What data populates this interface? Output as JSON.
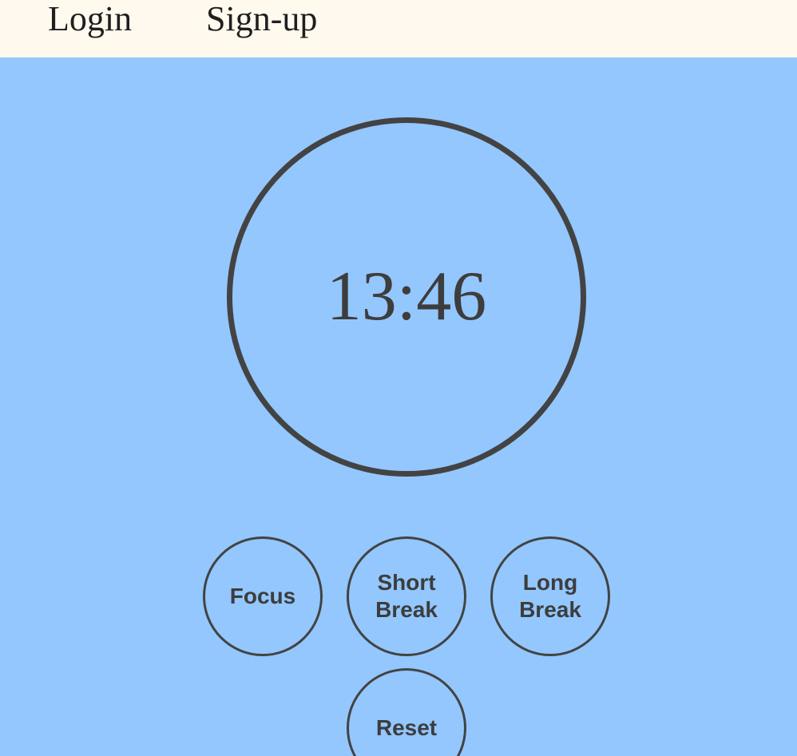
{
  "nav": {
    "login_label": "Login",
    "signup_label": "Sign-up"
  },
  "timer": {
    "display": "13:46"
  },
  "controls": {
    "focus_label": "Focus",
    "short_break_label": "Short Break",
    "long_break_label": "Long Break",
    "reset_label": "Reset"
  },
  "colors": {
    "background": "#93c7fd",
    "topbar": "#fff9ee",
    "ring": "#434343",
    "text": "#3d3d3d"
  }
}
